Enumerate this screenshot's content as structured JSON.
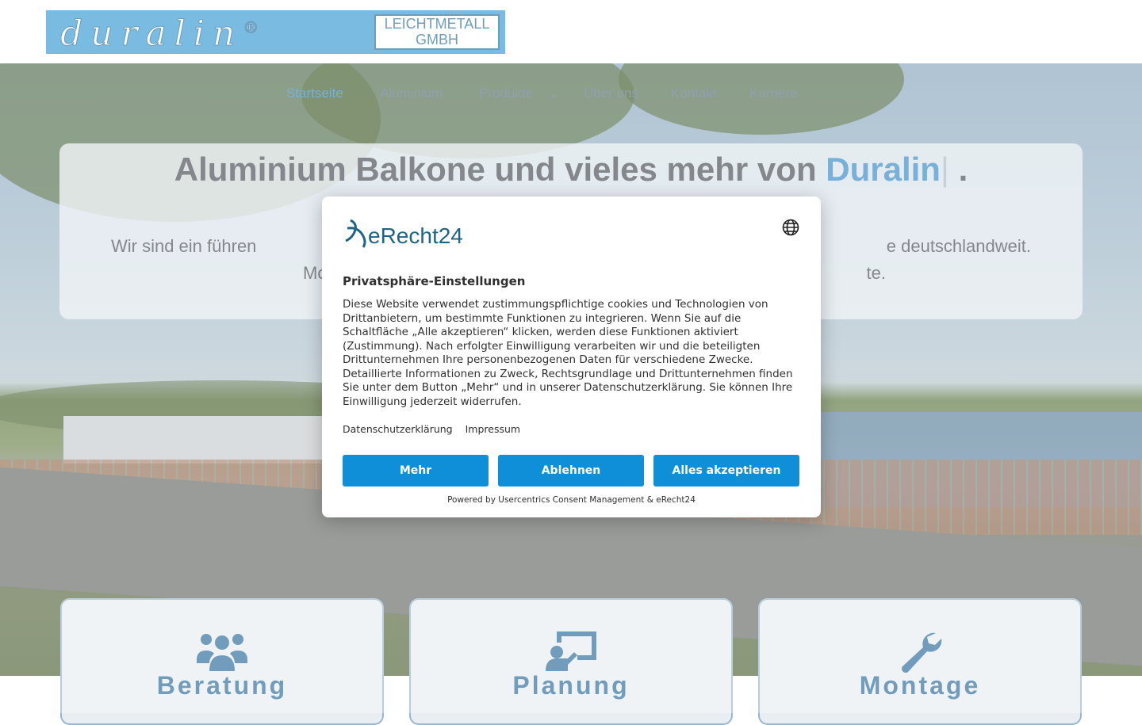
{
  "logo": {
    "brand": "duralin",
    "registered": "®",
    "line1": "LEICHTMETALL",
    "line2": "GMBH"
  },
  "nav": {
    "items": [
      {
        "label": "Startseite"
      },
      {
        "label": "Aluminium"
      },
      {
        "label": "Produkte"
      },
      {
        "label": "Über uns"
      },
      {
        "label": "Kontakt"
      },
      {
        "label": "Karriere"
      }
    ],
    "dropdown_icon": "chevron-down-icon"
  },
  "hero": {
    "title_prefix": "Aluminium Balkone und vieles mehr von",
    "title_accent": "Duralin",
    "title_suffix": ".",
    "text_line1": "Wir sind ein führen",
    "text_line1_end": "e deutschlandweit.",
    "text_line2": "Mo",
    "text_line2_end": "te."
  },
  "features": [
    {
      "title": "Beratung",
      "icon": "users-icon"
    },
    {
      "title": "Planung",
      "icon": "presentation-icon"
    },
    {
      "title": "Montage",
      "icon": "wrench-icon"
    }
  ],
  "consent": {
    "logo_text": "eRecht24",
    "language_icon": "globe-icon",
    "title": "Privatsphäre-Einstellungen",
    "body": "Diese Website verwendet zustimmungspflichtige cookies und Technologien von Drittanbietern, um bestimmte Funktionen zu integrieren. Wenn Sie auf die Schaltfläche „Alle akzeptieren“ klicken, werden diese Funktionen aktiviert (Zustimmung). Nach erfolgter Einwilligung verarbeiten wir und die beteiligten Drittunternehmen Ihre personenbezogenen Daten für verschiedene Zwecke. Detaillierte Informationen zu Zweck, Rechtsgrundlage und Drittunternehmen finden Sie unter dem Button „Mehr“ und in unserer Datenschutzerklärung. Sie können Ihre Einwilligung jederzeit widerrufen.",
    "link_privacy": "Datenschutzerklärung",
    "link_imprint": "Impressum",
    "btn_more": "Mehr",
    "btn_decline": "Ablehnen",
    "btn_accept": "Alles akzeptieren",
    "powered": "Powered by Usercentrics Consent Management & eRecht24",
    "accent_color": "#0f8fd8"
  }
}
